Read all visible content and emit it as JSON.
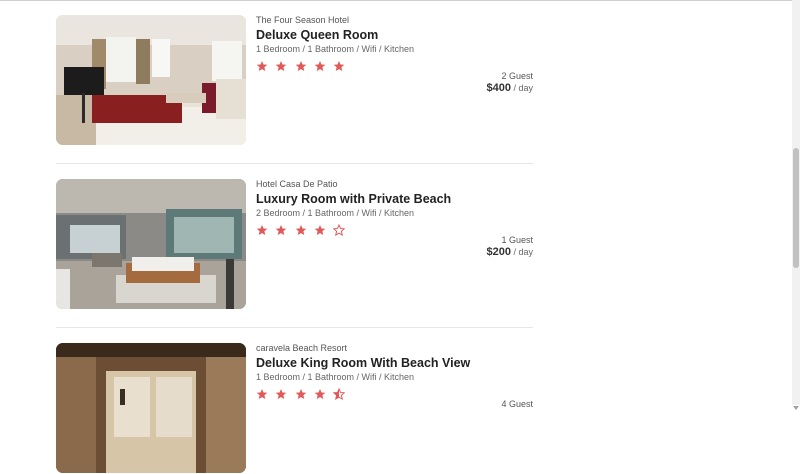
{
  "listings": [
    {
      "hotel": "The Four Season Hotel",
      "title": "Deluxe Queen Room",
      "amenities": "1 Bedroom / 1 Bathroom / Wifi / Kitchen",
      "rating": 5,
      "guests": "2 Guest",
      "price": "$400",
      "per": "/ day"
    },
    {
      "hotel": "Hotel Casa De Patio",
      "title": "Luxury Room with Private Beach",
      "amenities": "2 Bedroom / 1 Bathroom / Wifi / Kitchen",
      "rating": 4,
      "guests": "1 Guest",
      "price": "$200",
      "per": "/ day"
    },
    {
      "hotel": "caravela Beach Resort",
      "title": "Deluxe King Room With Beach View",
      "amenities": "1 Bedroom / 1 Bathroom / Wifi / Kitchen",
      "rating": 4.5,
      "guests": "4 Guest",
      "price": "",
      "per": ""
    }
  ],
  "colors": {
    "star": "#e05a5a",
    "divider": "#e6e6e6"
  },
  "icons": [
    "star-icon",
    "star-outline-icon",
    "star-half-icon"
  ]
}
